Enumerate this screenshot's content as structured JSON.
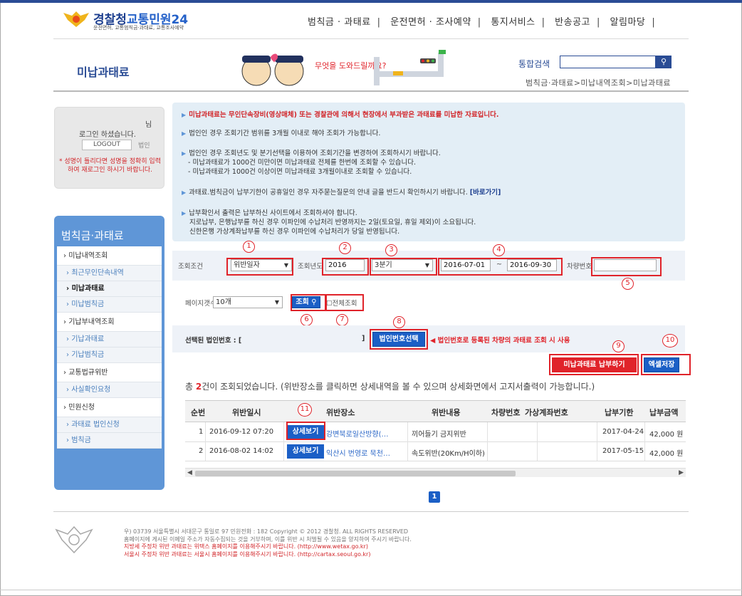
{
  "header": {
    "logo_name": "경찰청",
    "logo_highlight": "교통민원24",
    "logo_sub": "운전면허, 교통범칙금·과태료, 교통조사예약",
    "nav": [
      "범칙금 · 과태료",
      "운전면허 · 조사예약",
      "통지서비스",
      "반송공고",
      "알림마당"
    ]
  },
  "title_band": {
    "heading": "미납과태료",
    "mascot_text": "무엇을 도와드릴까요?",
    "search_label": "통합검색",
    "search_icon": "search-icon",
    "breadcrumb": "범칙금·과태료>미납내역조회>미납과태료"
  },
  "login": {
    "nim": "님",
    "message": "로그인 하셨습니다.",
    "logout_label": "LOGOUT",
    "user_type": "법인",
    "warning": "* 성명이 틀리다면 성명을 정확히 입력하여 재로그인 하시기 바랍니다."
  },
  "lnb": {
    "title": "범칙금·과태료",
    "items": [
      {
        "label": "미납내역조회",
        "type": "main"
      },
      {
        "label": "최근무인단속내역",
        "type": "sub"
      },
      {
        "label": "미납과태료",
        "type": "sub-active"
      },
      {
        "label": "미납범칙금",
        "type": "sub"
      },
      {
        "label": "기납부내역조회",
        "type": "main"
      },
      {
        "label": "기납과태료",
        "type": "sub"
      },
      {
        "label": "기납범칙금",
        "type": "sub"
      },
      {
        "label": "교통법규위반",
        "type": "main"
      },
      {
        "label": "사실확인요청",
        "type": "sub"
      },
      {
        "label": "민원신청",
        "type": "main"
      },
      {
        "label": "과태료 법인신청",
        "type": "sub"
      },
      {
        "label": "범칙금",
        "type": "sub"
      }
    ]
  },
  "info": {
    "line1": "미납과태료는 무인단속장비(영상매체) 또는 경찰관에 의해서 현장에서 부과받은 과태료를 미납한 자료입니다.",
    "line2": "법인인 경우 조회기간 범위를 3개월 이내로 해야 조회가 가능합니다.",
    "line3": "법인인 경우 조회년도 및 분기선택을 이용하여 조회기간을 변경하여 조회하시기 바랍니다.",
    "line3a": "- 미납과태료가 1000건 미만이면 미납과태료 전체를 한번에 조회할 수 있습니다.",
    "line3b": "- 미납과태료가 1000건 이상이면 미납과태료 3개월이내로 조회할 수 있습니다.",
    "line4": "과태료.범칙금이 납부기한이 공휴일인 경우 자주묻는질문의 안내 글을 반드시 확인하시기 바랍니다.",
    "line4_link": "[바로가기]",
    "line5": "납부확인서 출력은 납부하신 사이트에서 조회하셔야 합니다.",
    "line5a": "지로납부, 은행납부를 하신 경우 이파인에 수납처리 반영까지는 2일(토요일, 휴일 제외)이 소요됩니다.",
    "line5b": "신한은행 가상계좌납부를 하신 경우 이파인에 수납처리가 당일 반영됩니다."
  },
  "query": {
    "cond_label": "조회조건",
    "cond_value": "위반일자",
    "year_label": "조회년도",
    "year_value": "2016",
    "quarter_value": "3분기",
    "date_from": "2016-07-01",
    "tilde": "~",
    "date_to": "2016-09-30",
    "car_label": "차량번호",
    "car_value": "",
    "page_label": "페이지갯수",
    "page_value": "10개",
    "search_button": "조회",
    "all_label": "전체조회",
    "corp_label": "선택된 법인번호 : [",
    "corp_close": "]",
    "corp_button": "법인번호선택",
    "corp_note": "◀ 법인번호로 등록된 차량의 과태료 조회 시 사용",
    "pay_button": "미납과태료 납부하기",
    "excel_button": "엑셀저장"
  },
  "markers": [
    "1",
    "2",
    "3",
    "4",
    "5",
    "6",
    "7",
    "8",
    "9",
    "10",
    "11"
  ],
  "summary": {
    "prefix": "총 ",
    "count": "2",
    "suffix": "건이 조회되었습니다. (위반장소를 클릭하면 상세내역을 볼 수 있으며 상세화면에서 고지서출력이 가능합니다.)"
  },
  "table": {
    "headers": [
      "순번",
      "위반일시",
      "위반장소",
      "위반내용",
      "차량번호",
      "가상계좌번호",
      "납부기한",
      "납부금액"
    ],
    "detail_label": "상세보기",
    "rows": [
      {
        "no": "1",
        "datetime": "2016-09-12 07:20",
        "place": "강변북로일산방향(…",
        "content": "끼어들기 금지위반",
        "car": "",
        "account": "",
        "due": "2017-04-24",
        "amount": "42,000 원"
      },
      {
        "no": "2",
        "datetime": "2016-08-02 14:02",
        "place": "익산시 번영로 묵천…",
        "content": "속도위반(20Km/H이하)",
        "car": "",
        "account": "",
        "due": "2017-05-15",
        "amount": "42,000 원"
      }
    ]
  },
  "pager": {
    "current": "1"
  },
  "footer": {
    "line1": "우) 03739 서울특별시 서대문구 통일로 97 민원전화 : 182      Copyright © 2012 경찰청. ALL RIGHTS RESERVED",
    "line2": "홈페이지에 게시된 이메일 주소가 자동수집되는 것을 거부하며, 이를 위반 시 처벌될 수 있음을 양지하여 주시기 바랍니다.",
    "line3": "지방세 주정차 위반 과태료는 위택스 홈페이지를 이용해주시기 바랍니다. (http://www.wetax.go.kr)",
    "line4": "서울시 주정차 위반 과태료는 서울시 홈페이지를 이용해주시기 바랍니다. (http://cartax.seoul.go.kr)"
  },
  "colors": {
    "brand": "#2a4c95",
    "accent_blue": "#1b5fc6",
    "alert_red": "#e0232a",
    "lnb_blue": "#5f96d7",
    "info_bg": "#e3eef6"
  }
}
